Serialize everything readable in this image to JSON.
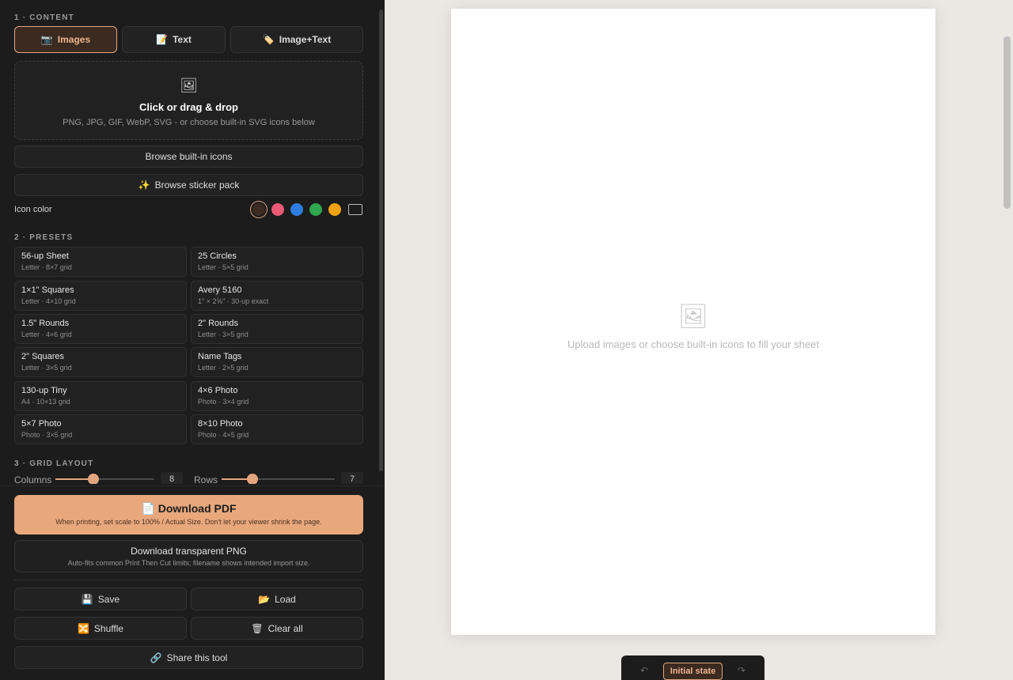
{
  "sections": {
    "content": "1 · CONTENT",
    "presets": "2 · PRESETS",
    "grid": "3 · GRID LAYOUT"
  },
  "tabs": [
    {
      "label": "Images",
      "icon": "camera-icon",
      "glyph": "📷"
    },
    {
      "label": "Text",
      "icon": "document-icon",
      "glyph": "📝"
    },
    {
      "label": "Image+Text",
      "icon": "tag-icon",
      "glyph": "🏷️"
    }
  ],
  "dropzone": {
    "glyph": "🖼",
    "title": "Click or drag & drop",
    "subtitle": "PNG, JPG, GIF, WebP, SVG - or choose built-in SVG icons below"
  },
  "buttons": {
    "browse_icons": "Browse built-in icons",
    "browse_stickers": "Browse sticker pack",
    "sparkle": "✨"
  },
  "icon_color": {
    "label": "Icon color",
    "swatches": [
      "#3a2a20",
      "#e85a75",
      "#2f7de1",
      "#2fa84f",
      "#f0a010",
      "transparent"
    ]
  },
  "presets": [
    {
      "name": "56-up Sheet",
      "sub": "Letter · 8×7 grid"
    },
    {
      "name": "25 Circles",
      "sub": "Letter · 5×5 grid"
    },
    {
      "name": "1×1\" Squares",
      "sub": "Letter · 4×10 grid"
    },
    {
      "name": "Avery 5160",
      "sub": "1\" × 2⅝\" · 30-up exact"
    },
    {
      "name": "1.5\" Rounds",
      "sub": "Letter · 4×6 grid"
    },
    {
      "name": "2\" Rounds",
      "sub": "Letter · 3×5 grid"
    },
    {
      "name": "2\" Squares",
      "sub": "Letter · 3×5 grid"
    },
    {
      "name": "Name Tags",
      "sub": "Letter · 2×5 grid"
    },
    {
      "name": "130-up Tiny",
      "sub": "A4 · 10×13 grid"
    },
    {
      "name": "4×6 Photo",
      "sub": "Photo · 3×4 grid"
    },
    {
      "name": "5×7 Photo",
      "sub": "Photo · 3×5 grid"
    },
    {
      "name": "8×10 Photo",
      "sub": "Photo · 4×5 grid"
    }
  ],
  "grid": {
    "columns_label": "Columns",
    "columns_value": "8",
    "rows_label": "Rows",
    "rows_value": "7"
  },
  "download": {
    "pdf_glyph": "📄",
    "pdf_title": "Download PDF",
    "pdf_sub": "When printing, set scale to 100% / Actual Size. Don't let your viewer shrink the page.",
    "png_title": "Download transparent PNG",
    "png_sub": "Auto-fits common Print Then Cut limits; filename shows intended import size."
  },
  "actions": {
    "save": "Save",
    "save_glyph": "💾",
    "load": "Load",
    "load_glyph": "📂",
    "shuffle": "Shuffle",
    "shuffle_glyph": "🔀",
    "clear": "Clear all",
    "clear_glyph": "🗑",
    "share": "Share this tool",
    "share_glyph": "🔗"
  },
  "canvas": {
    "empty_glyph": "🖼",
    "empty_text": "Upload images or choose built-in icons to fill your sheet"
  },
  "history": {
    "undo": "↶",
    "redo": "↷",
    "state": "Initial state"
  },
  "colors": {
    "accent": "#e8a87c",
    "sidebar_bg": "#1c1c1c",
    "canvas_bg": "#ebe8e3"
  }
}
